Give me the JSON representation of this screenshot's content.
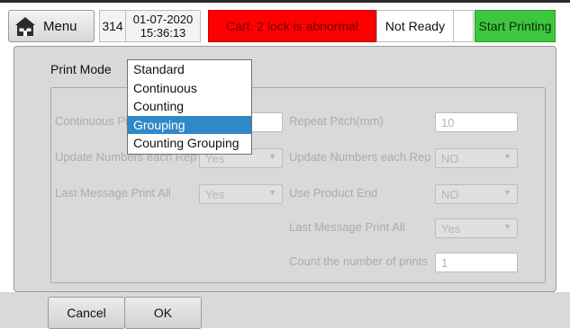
{
  "header": {
    "menu_label": "Menu",
    "print_count": "314",
    "date": "01-07-2020",
    "time": "15:36:13",
    "alarm_text": "Cart. 2 lock is abnormal",
    "status_text": "Not Ready",
    "start_label": "Start Printing",
    "colors": {
      "alarm": "#ff0000",
      "start": "#3ec63e"
    }
  },
  "dialog": {
    "print_mode_label": "Print Mode",
    "print_mode_options": [
      "Standard",
      "Continuous",
      "Counting",
      "Grouping",
      "Counting Grouping"
    ],
    "selected_option": "Grouping",
    "left_fields": {
      "continuous_pitch_label": "Continuous Pitch(mm)",
      "update_numbers_label": "Update Numbers each Rep",
      "update_numbers_value": "Yes",
      "last_message_label": "Last Message Print All",
      "last_message_value": "Yes"
    },
    "right_fields": {
      "repeat_pitch_label": "Repeat Pitch(mm)",
      "repeat_pitch_value": "10",
      "update_numbers_label": "Update Numbers each Rep",
      "update_numbers_value": "NO",
      "use_product_end_label": "Use Product End",
      "use_product_end_value": "NO",
      "last_message_label": "Last Message Print All",
      "last_message_value": "Yes",
      "count_prints_label": "Count the number of prints",
      "count_prints_value": "1"
    }
  },
  "footer": {
    "cancel_label": "Cancel",
    "ok_label": "OK"
  }
}
